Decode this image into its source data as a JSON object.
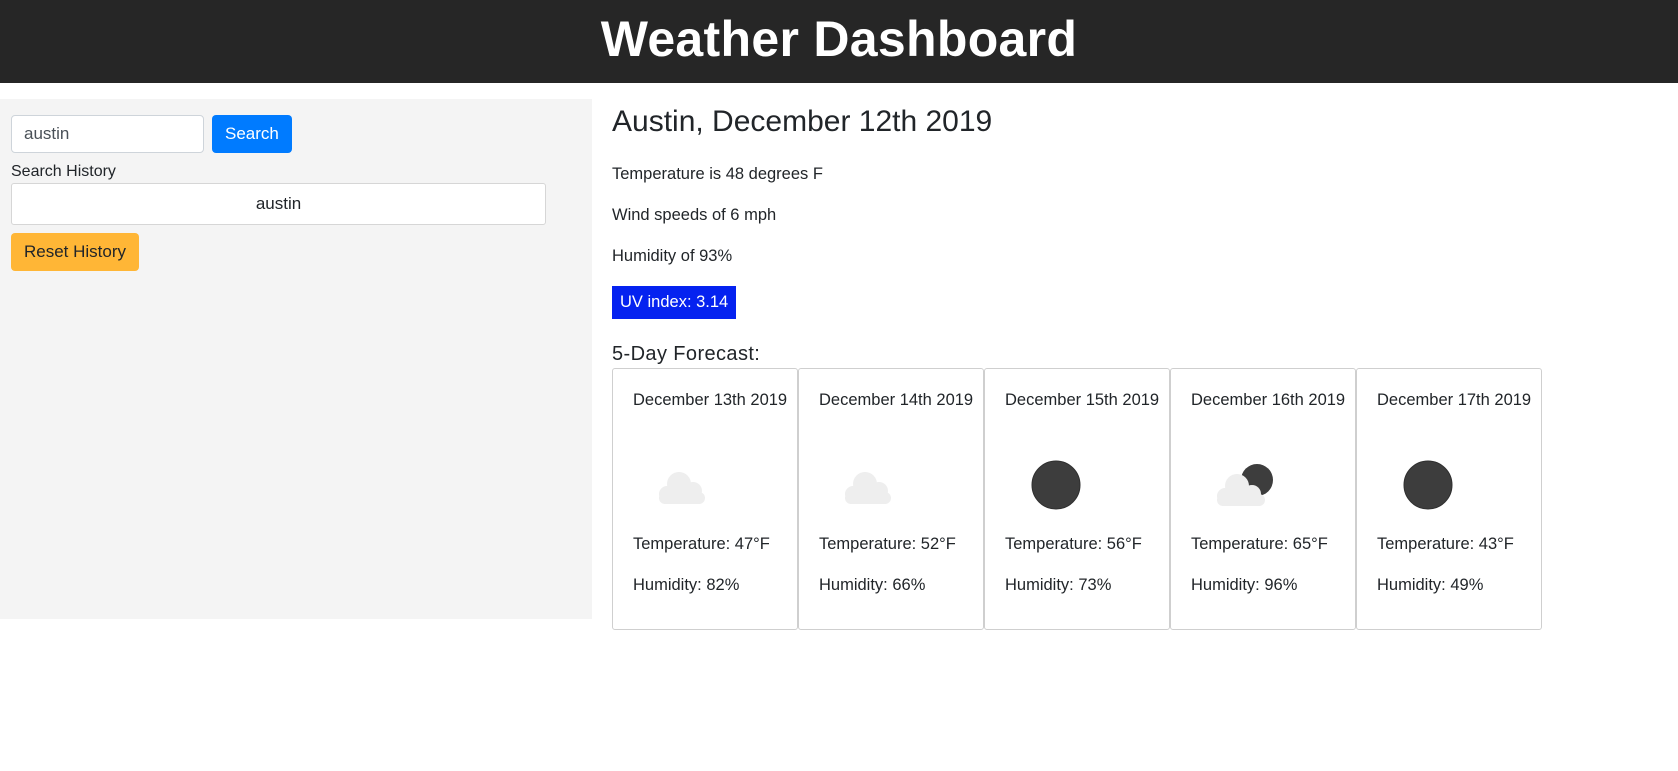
{
  "header": {
    "title": "Weather Dashboard"
  },
  "sidebar": {
    "search": {
      "value": "austin",
      "button_label": "Search"
    },
    "history_label": "Search History",
    "history": [
      "austin"
    ],
    "reset_label": "Reset History"
  },
  "current": {
    "title": "Austin, December 12th 2019",
    "temperature": "Temperature is 48 degrees F",
    "wind": "Wind speeds of 6 mph",
    "humidity": "Humidity of 93%",
    "uv": "UV index: 3.14"
  },
  "forecast": {
    "title": "5-Day Forecast:",
    "days": [
      {
        "date": "December 13th 2019",
        "icon": "cloud-icon",
        "temp": "Temperature: 47°F",
        "humidity": "Humidity: 82%"
      },
      {
        "date": "December 14th 2019",
        "icon": "cloud-icon",
        "temp": "Temperature: 52°F",
        "humidity": "Humidity: 66%"
      },
      {
        "date": "December 15th 2019",
        "icon": "clear-night-icon",
        "temp": "Temperature: 56°F",
        "humidity": "Humidity: 73%"
      },
      {
        "date": "December 16th 2019",
        "icon": "partly-cloudy-night-icon",
        "temp": "Temperature: 65°F",
        "humidity": "Humidity: 96%"
      },
      {
        "date": "December 17th 2019",
        "icon": "clear-night-icon",
        "temp": "Temperature: 43°F",
        "humidity": "Humidity: 49%"
      }
    ]
  },
  "colors": {
    "header_bg": "#262626",
    "primary": "#007bff",
    "warning": "#ffb636",
    "uv_bg": "#0522f0",
    "sidebar_bg": "#f4f4f4"
  }
}
